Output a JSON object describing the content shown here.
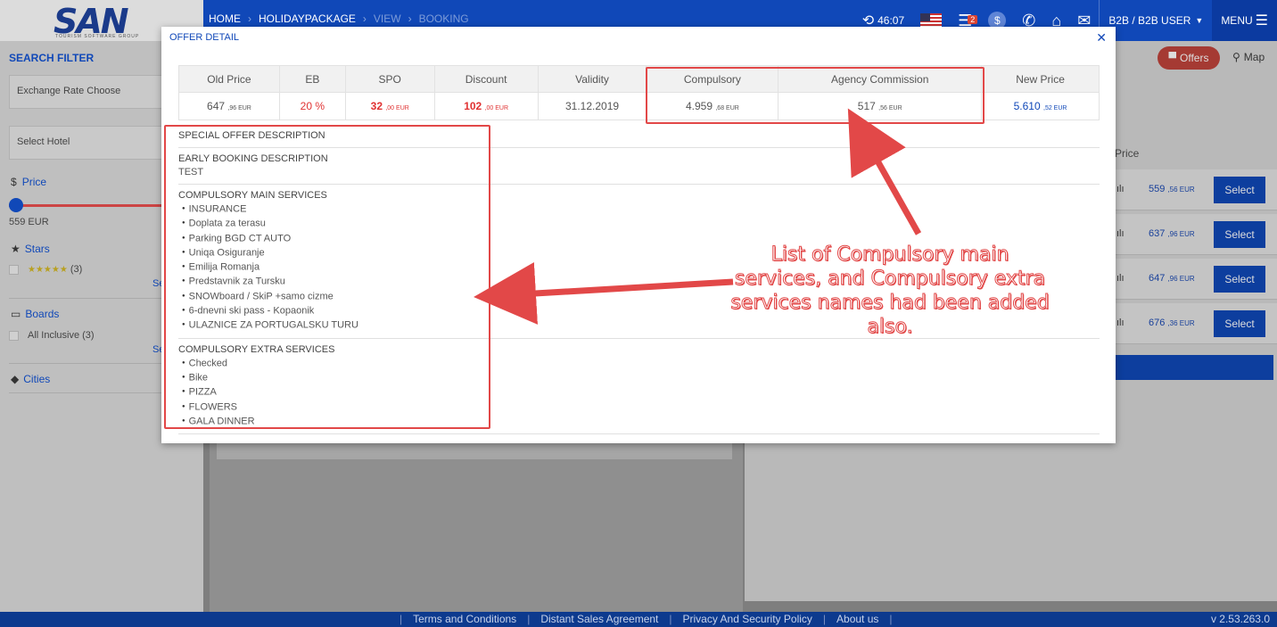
{
  "header": {
    "logo": "SAN",
    "logo_sub": "TOURISM SOFTWARE GROUP",
    "breadcrumbs": [
      "HOME",
      "HOLIDAYPACKAGE",
      "VIEW",
      "BOOKING"
    ],
    "timer": "46:07",
    "cart_count": "2",
    "user": "B2B / B2B USER",
    "menu": "MENU"
  },
  "sidebar": {
    "title": "SEARCH FILTER",
    "exchange_rate": "Exchange Rate Choose",
    "select_hotel": "Select Hotel",
    "price_label": "Price",
    "price_value": "559 EUR",
    "stars_label": "Stars",
    "stars_count": "(3)",
    "boards_label": "Boards",
    "boards_item": "All Inclusive (3)",
    "cities_label": "Cities",
    "see_more": "Se"
  },
  "results": {
    "offers_label": "Offers",
    "map_label": "Map",
    "price_header": "Price",
    "rows": [
      {
        "price": "559",
        "decimals": ",56 EUR",
        "select": "Select"
      },
      {
        "price": "637",
        "decimals": ",96 EUR",
        "select": "Select"
      },
      {
        "price": "647",
        "decimals": ",96 EUR",
        "select": "Select"
      },
      {
        "price": "676",
        "decimals": ",36 EUR",
        "select": "Select"
      }
    ]
  },
  "modal": {
    "title": "OFFER DETAIL",
    "columns": [
      "Old Price",
      "EB",
      "SPO",
      "Discount",
      "Validity",
      "Compulsory",
      "Agency Commission",
      "New Price"
    ],
    "row": {
      "old_price": "647",
      "old_price_dec": ",96 EUR",
      "eb": "20 %",
      "spo": "32",
      "spo_dec": ",00 EUR",
      "discount": "102",
      "discount_dec": ",00 EUR",
      "validity": "31.12.2019",
      "compulsory": "4.959",
      "compulsory_dec": ",68 EUR",
      "agency_commission": "517",
      "agency_commission_dec": ",56 EUR",
      "new_price": "5.610",
      "new_price_dec": ",52 EUR"
    },
    "special_offer_heading": "SPECIAL OFFER DESCRIPTION",
    "early_booking_heading": "EARLY BOOKING DESCRIPTION",
    "early_booking_text": "TEST",
    "compulsory_main_heading": "COMPULSORY MAIN SERVICES",
    "compulsory_main": [
      "INSURANCE",
      "Doplata za terasu",
      "Parking BGD CT AUTO",
      "Uniqa Osiguranje",
      "Emilija Romanja",
      "Predstavnik za Tursku",
      "SNOWboard / SkiP +samo cizme",
      "6-dnevni ski pass - Kopaonik",
      "ULAZNICE ZA PORTUGALSKU TURU"
    ],
    "compulsory_extra_heading": "COMPULSORY EXTRA SERVICES",
    "compulsory_extra": [
      "Checked",
      "Bike",
      "PIZZA",
      "FLOWERS",
      "GALA DINNER"
    ]
  },
  "annotation": {
    "text": "List of Compulsory main services, and Compulsory extra services names had been added also.",
    "color": "#e24848"
  },
  "footer": {
    "links": [
      "Terms and Conditions",
      "Distant Sales Agreement",
      "Privacy And Security Policy",
      "About us"
    ],
    "version": "v 2.53.263.0"
  }
}
